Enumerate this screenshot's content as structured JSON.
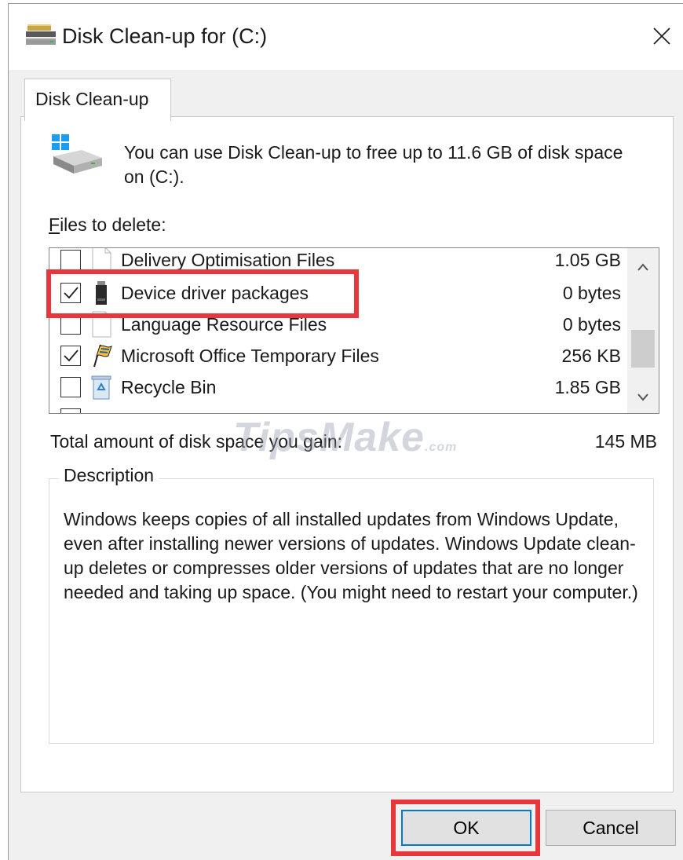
{
  "window": {
    "title": "Disk Clean-up for  (C:)",
    "close_label": "✕"
  },
  "tab": {
    "label": "Disk Clean-up"
  },
  "intro": {
    "text": "You can use Disk Clean-up to free up to 11.6 GB of disk space on  (C:)."
  },
  "files_label": {
    "accel": "F",
    "rest": "iles to delete:"
  },
  "files": [
    {
      "name": "Delivery Optimisation Files",
      "size": "1.05 GB",
      "checked": false,
      "icon": "blank-file-icon"
    },
    {
      "name": "Device driver packages",
      "size": "0 bytes",
      "checked": true,
      "icon": "usb-drive-icon"
    },
    {
      "name": "Language Resource Files",
      "size": "0 bytes",
      "checked": false,
      "icon": "blank-file-icon"
    },
    {
      "name": "Microsoft Office Temporary Files",
      "size": "256 KB",
      "checked": true,
      "icon": "office-flag-icon"
    },
    {
      "name": "Recycle Bin",
      "size": "1.85 GB",
      "checked": false,
      "icon": "recycle-bin-icon"
    }
  ],
  "total": {
    "label": "Total amount of disk space you gain:",
    "value": "145 MB"
  },
  "description": {
    "legend": "Description",
    "text": "Windows keeps copies of all installed updates from Windows Update, even after installing newer versions of updates. Windows Update clean-up deletes or compresses older versions of updates that are no longer needed and taking up space. (You might need to restart your computer.)"
  },
  "buttons": {
    "ok": "OK",
    "cancel": "Cancel"
  },
  "watermark": {
    "main": "TipsMake",
    "sub": ".com"
  },
  "colors": {
    "highlight": "#e5373c",
    "focus": "#0078d7"
  }
}
